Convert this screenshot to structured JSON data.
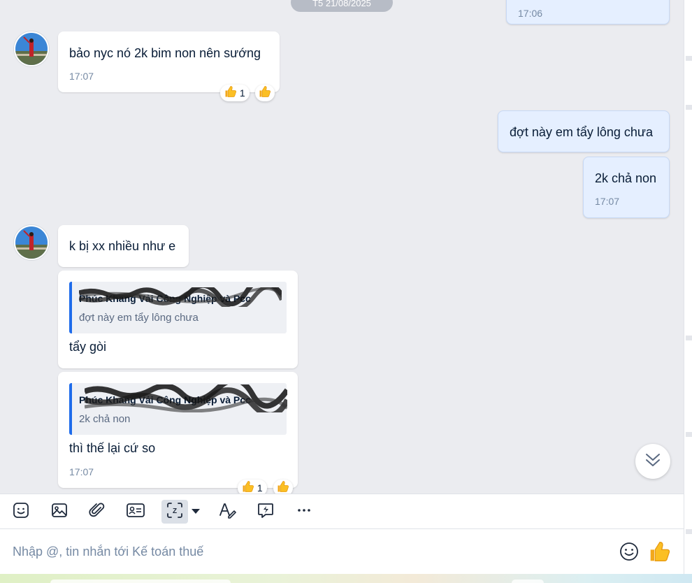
{
  "date_separator": "T5 21/08/2025",
  "messages": {
    "m0": {
      "time": "17:06"
    },
    "m1": {
      "text": "bảo nyc nó 2k bim non nên sướng",
      "time": "17:07",
      "reaction_count": "1"
    },
    "m2": {
      "text": "đợt này em tẩy lông chưa"
    },
    "m3": {
      "text": "2k chả non",
      "time": "17:07"
    },
    "m4": {
      "text": "k bị xx nhiều như e"
    },
    "m5": {
      "quote_sender": "Phúc Khang Vải Công Nghiệp và Pcc",
      "quote_text": "đợt này em tẩy lông chưa",
      "text": "tẩy gòi"
    },
    "m6": {
      "quote_sender": "Phúc Khang Vải Công Nghiệp và Pcc",
      "quote_text": "2k chả non",
      "text": "thì thế lại cứ so",
      "time": "17:07",
      "reaction_count": "1"
    }
  },
  "toolbar": {
    "items": [
      "sticker-icon",
      "image-icon",
      "attachment-icon",
      "contact-card-icon",
      "screenshot-icon",
      "format-text-icon",
      "quick-message-icon",
      "more-icon"
    ]
  },
  "composer": {
    "placeholder": "Nhập @, tin nhắn tới Kế toán thuế"
  },
  "colors": {
    "chat_bg": "#ebecf0",
    "outgoing_bubble": "#e5efff",
    "incoming_bubble": "#ffffff",
    "quote_accent": "#1f6ceb",
    "time_text": "#7589a3"
  }
}
